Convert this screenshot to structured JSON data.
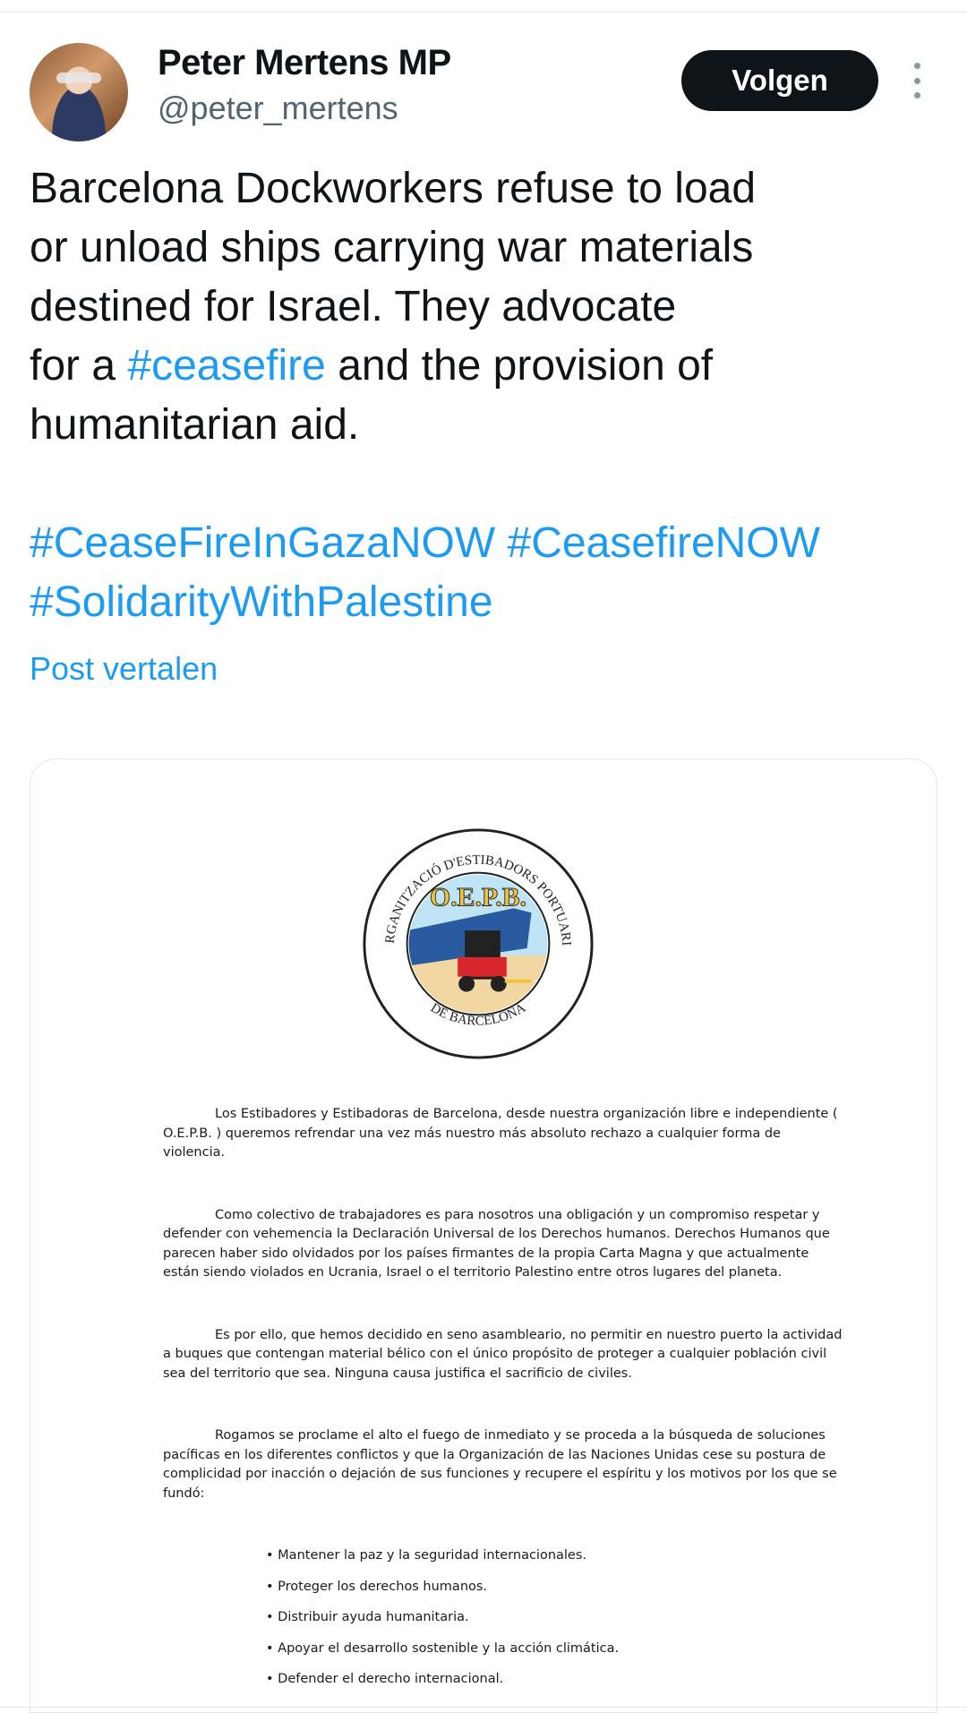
{
  "author": {
    "display_name": "Peter Mertens MP",
    "handle": "@peter_mertens"
  },
  "header": {
    "follow_label": "Volgen",
    "more_icon": "more-vertical-icon"
  },
  "tweet": {
    "lines": [
      "Barcelona Dockworkers refuse to load",
      "or unload ships carrying war materials",
      "destined for Israel. They advocate"
    ],
    "line4_pre": "for a ",
    "line4_hashtag": "#ceasefire",
    "line4_post": " and the provision of",
    "line5": "humanitarian aid.",
    "hashtags": [
      "#CeaseFireInGazaNOW",
      "#CeasefireNOW",
      "#SolidarityWithPalestine"
    ],
    "translate_label": "Post vertalen",
    "link_color": "#1d9bf0"
  },
  "document": {
    "logo": {
      "ring_text_top": "ORGANITZACIÓ D'ESTIBADORS PORTUARIS",
      "ring_text_bottom": "DE BARCELONA",
      "center_text": "O.E.P.B."
    },
    "paragraphs": [
      "Los Estibadores y Estibadoras de Barcelona, desde nuestra organización libre e independiente ( O.E.P.B. ) queremos refrendar una vez más nuestro más absoluto rechazo a cualquier forma de violencia.",
      "Como colectivo de trabajadores es para nosotros una obligación y un compromiso respetar y defender con vehemencia la Declaración Universal de los Derechos humanos. Derechos Humanos que parecen haber sido olvidados por los países firmantes de la propia Carta Magna y que actualmente están siendo violados en Ucrania, Israel o el territorio Palestino entre otros lugares del planeta.",
      "Es por ello, que hemos decidido en seno asambleario, no permitir en nuestro puerto la actividad a buques que contengan material bélico con el único propósito de proteger a cualquier población civil sea del territorio que sea. Ninguna causa justifica el sacrificio de civiles.",
      "Rogamos se proclame el alto el fuego de inmediato y se proceda a la búsqueda de soluciones pacíficas en los diferentes conflictos y que la Organización de las Naciones Unidas cese su postura de complicidad por inacción o dejación de sus funciones y recupere el espíritu y los motivos por los que se fundó:"
    ],
    "bullets": [
      "Mantener la paz y la seguridad internacionales.",
      "Proteger los derechos humanos.",
      "Distribuir ayuda humanitaria.",
      "Apoyar el desarrollo sostenible y la acción climática.",
      "Defender el derecho internacional."
    ]
  }
}
